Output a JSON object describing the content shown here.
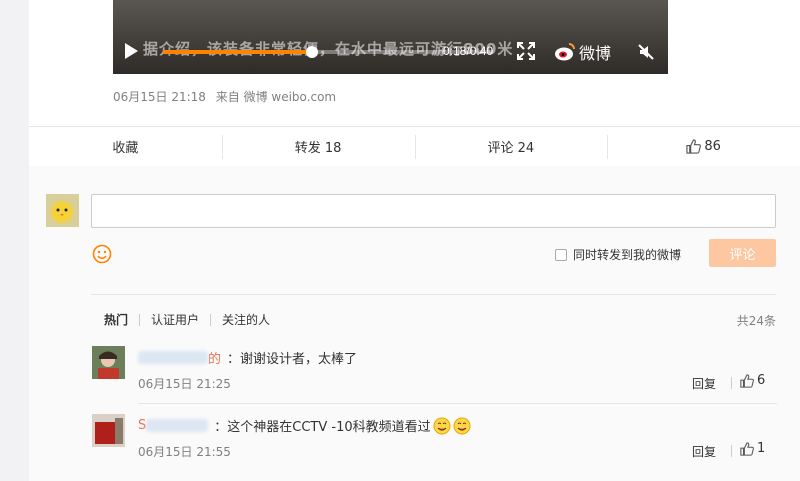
{
  "video": {
    "caption": "据介绍，该装备非常轻便，在水中最远可游行800米",
    "progress": 0.45,
    "time": "0:18/0:40",
    "brand": "微博"
  },
  "post_meta": {
    "date": "06月15日 21:18",
    "source": "来自 微博 weibo.com"
  },
  "actions": {
    "favorite": "收藏",
    "forward": "转发 18",
    "comment": "评论 24",
    "like_count": "86"
  },
  "composer": {
    "forward_option": "同时转发到我的微博",
    "submit": "评论"
  },
  "filters": {
    "items": [
      "热门",
      "认证用户",
      "关注的人"
    ],
    "total": "共24条"
  },
  "comments": [
    {
      "name_suffix": "的",
      "text": "：谢谢设计者，太棒了",
      "time": "06月15日 21:25",
      "reply": "回复",
      "likes": "6"
    },
    {
      "name_suffix": "S",
      "text": "：这个神器在CCTV -10科教频道看过",
      "time": "06月15日 21:55",
      "reply": "回复",
      "likes": "1"
    }
  ],
  "colors": {
    "accent": "#ff8200",
    "submit_disabled": "#fdc7a2",
    "link": "#eb7350"
  }
}
